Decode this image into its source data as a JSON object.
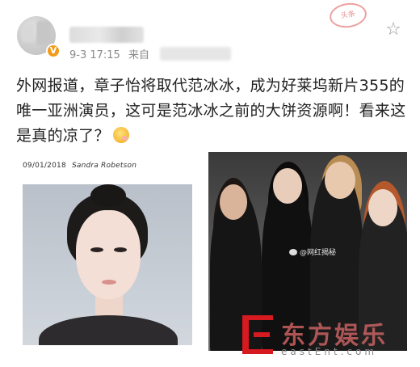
{
  "post": {
    "meta_date": "9-3 17:15",
    "meta_source": "来自",
    "stamp_text": "头条",
    "body_text": "外网报道，章子怡将取代范冰冰，成为好莱坞新片355的唯一亚洲演员，这可是范冰冰之前的大饼资源啊！看来这是真的凉了？",
    "emoji_name": "thinking-emoji"
  },
  "left_image": {
    "byline_date": "09/01/2018",
    "byline_author": "Sandra Robetson"
  },
  "right_image": {
    "watermark": "@网红揭秘"
  },
  "site_watermark": {
    "cn": "东方娱乐",
    "en": "eastEnt.com",
    "color": "#d71920"
  },
  "icons": {
    "star": "star-outline-icon",
    "verified": "verified-v-badge"
  }
}
